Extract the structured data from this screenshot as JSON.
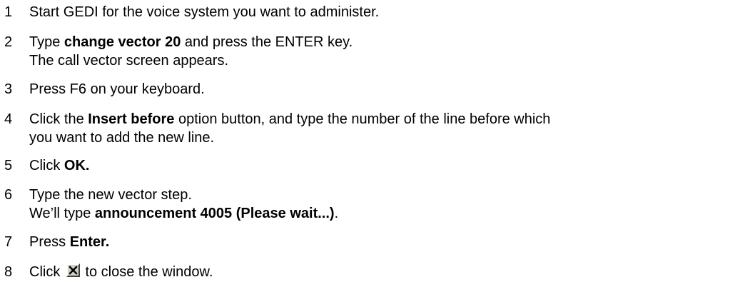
{
  "steps": [
    {
      "number": "1",
      "lines": [
        {
          "parts": [
            "Start GEDI for the voice system you want to administer."
          ]
        }
      ]
    },
    {
      "number": "2",
      "lines": [
        {
          "parts": [
            "Type ",
            "change vector 20",
            " and press the ENTER key."
          ]
        },
        {
          "parts": [
            "The call vector screen appears."
          ]
        }
      ]
    },
    {
      "number": "3",
      "lines": [
        {
          "parts": [
            "Press F6 on your keyboard."
          ]
        }
      ]
    },
    {
      "number": "4",
      "lines": [
        {
          "parts": [
            "Click the ",
            "Insert before",
            " option button, and type the number of the line before which"
          ]
        },
        {
          "parts": [
            "you want to add the new line."
          ]
        }
      ]
    },
    {
      "number": "5",
      "lines": [
        {
          "parts": [
            "Click ",
            "OK."
          ]
        }
      ]
    },
    {
      "number": "6",
      "lines": [
        {
          "parts": [
            "Type the new vector step."
          ]
        },
        {
          "parts": [
            "We’ll type ",
            "announcement 4005 (Please wait...)",
            "."
          ]
        }
      ]
    },
    {
      "number": "7",
      "lines": [
        {
          "parts": [
            "Press ",
            "Enter."
          ]
        }
      ]
    },
    {
      "number": "8",
      "lines": [
        {
          "parts": [
            "Click ",
            " to close the window."
          ]
        }
      ]
    }
  ],
  "icons": {
    "close_window": "close-window-icon"
  },
  "colors": {
    "text": "#000000",
    "button_face": "#d4d0c8"
  }
}
